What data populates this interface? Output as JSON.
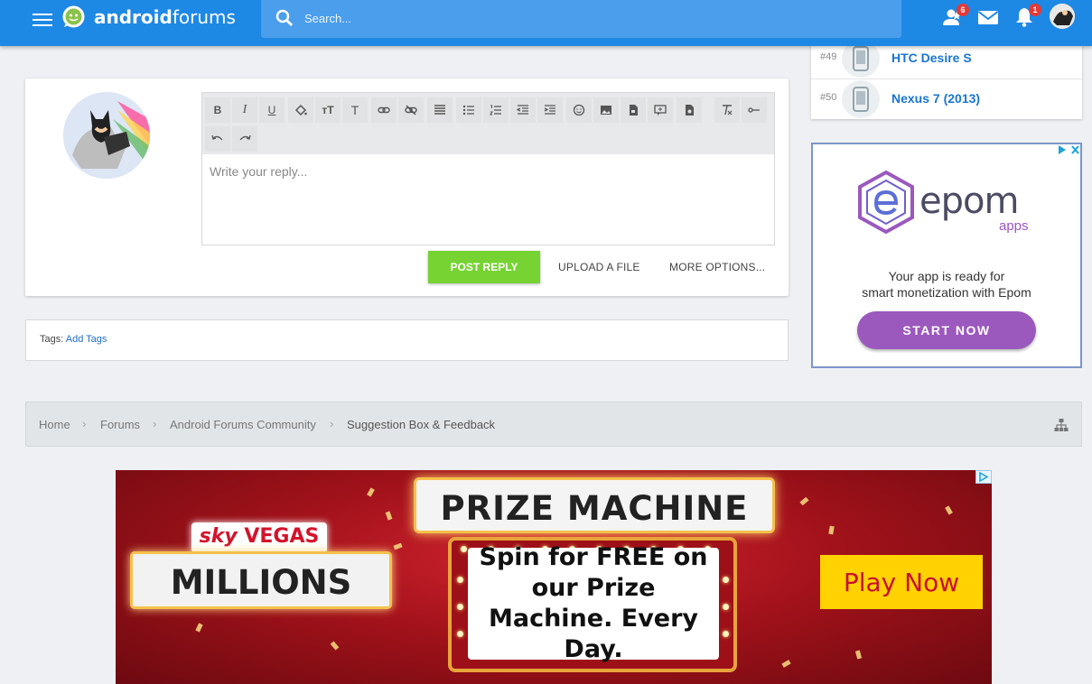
{
  "header": {
    "logo_bold": "android",
    "logo_light": "forums",
    "search_placeholder": "Search...",
    "notifications": {
      "friends_count": "6",
      "alerts_count": "1"
    },
    "accent_color": "#1e88e5"
  },
  "devices": [
    {
      "rank": "#49",
      "name": "HTC Desire S",
      "icon": "phone-icon"
    },
    {
      "rank": "#50",
      "name": "Nexus 7 (2013)",
      "icon": "phone-icon"
    }
  ],
  "editor": {
    "placeholder": "Write your reply...",
    "toolbar": [
      "bold",
      "italic",
      "underline",
      "text-color",
      "font-size",
      "text",
      "link",
      "unlink",
      "align",
      "bullet-list",
      "numbered-list",
      "outdent",
      "indent",
      "smilie",
      "image",
      "media",
      "quote",
      "spoiler",
      "remove-format",
      "more",
      "undo",
      "redo"
    ],
    "post_reply": "POST REPLY",
    "upload_file": "UPLOAD A FILE",
    "more_options": "MORE OPTIONS..."
  },
  "tags": {
    "label": "Tags:",
    "add": "Add Tags"
  },
  "breadcrumb": [
    "Home",
    "Forums",
    "Android Forums Community",
    "Suggestion Box & Feedback"
  ],
  "ad_epom": {
    "brand": "epom",
    "sub": "apps",
    "line1": "Your app is ready for",
    "line2": "smart monetization with Epom",
    "button": "START NOW",
    "button_color": "#9b59be"
  },
  "ad_sky": {
    "sky": "sky",
    "vegas": "VEGAS",
    "millions": "MILLIONS",
    "prize": "PRIZE MACHINE",
    "spin": "Spin for FREE on our Prize Machine. Every Day.",
    "play": "Play Now"
  }
}
